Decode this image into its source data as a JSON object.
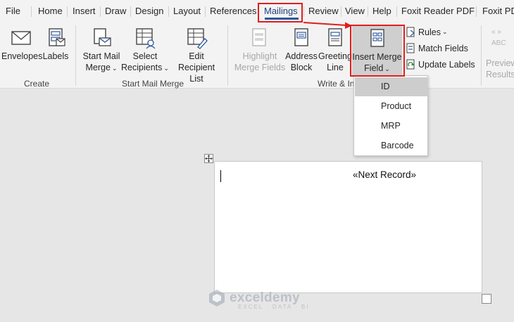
{
  "tabs": [
    "File",
    "Home",
    "Insert",
    "Draw",
    "Design",
    "Layout",
    "References",
    "Mailings",
    "Review",
    "View",
    "Help",
    "Foxit Reader PDF",
    "Foxit PD"
  ],
  "active_tab": "Mailings",
  "ribbon": {
    "create": {
      "group_label": "Create",
      "envelopes": "Envelopes",
      "labels": "Labels"
    },
    "start_mail_merge": {
      "group_label": "Start Mail Merge",
      "start_line1": "Start Mail",
      "start_line2": "Merge",
      "select_line1": "Select",
      "select_line2": "Recipients",
      "edit_line1": "Edit",
      "edit_line2": "Recipient List"
    },
    "write_insert": {
      "group_label": "Write & In",
      "highlight_line1": "Highlight",
      "highlight_line2": "Merge Fields",
      "address_line1": "Address",
      "address_line2": "Block",
      "greeting_line1": "Greeting",
      "greeting_line2": "Line",
      "insert_merge_line1": "Insert Merge",
      "insert_merge_line2": "Field",
      "rules": "Rules",
      "match_fields": "Match Fields",
      "update_labels": "Update Labels"
    },
    "preview": {
      "abc": "ABC",
      "line1": "Preview",
      "line2": "Results"
    }
  },
  "dropdown": {
    "items": [
      "ID",
      "Product",
      "MRP",
      "Barcode"
    ],
    "selected": "ID"
  },
  "document": {
    "next_record": "«Next Record»"
  },
  "watermark": {
    "name": "exceldemy",
    "tagline": "EXCEL · DATA · BI"
  },
  "colors": {
    "highlight_red": "#e01e1e",
    "word_blue": "#2b579a",
    "ribbon_bg": "#f3f3f3",
    "canvas_bg": "#e6e6e6"
  }
}
